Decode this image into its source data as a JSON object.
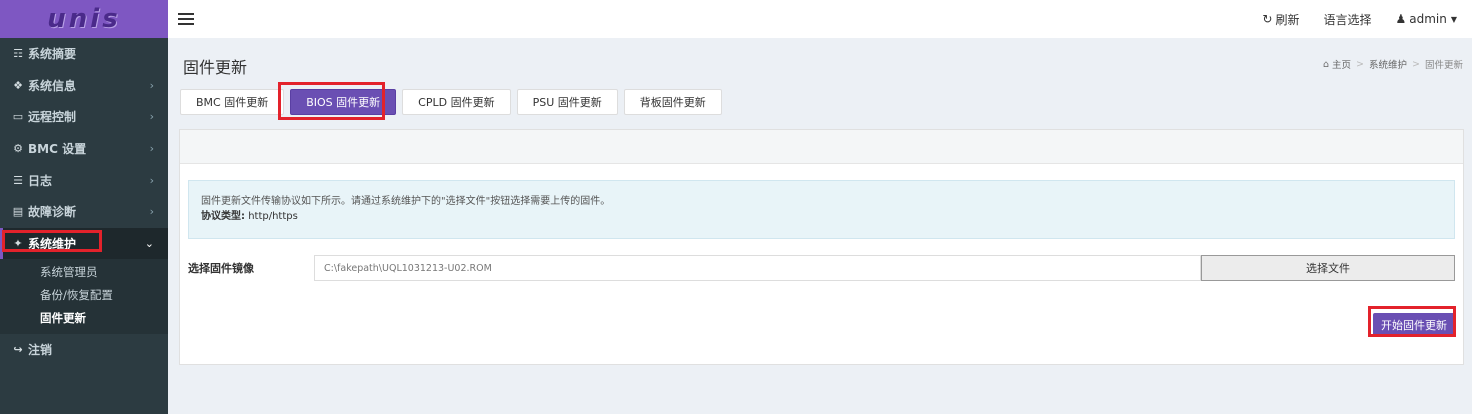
{
  "app": {
    "logo_text": "unis",
    "brand_color": "#7e57c2"
  },
  "header": {
    "refresh_label": "刷新",
    "language_label": "语言选择",
    "user_label": "admin"
  },
  "sidebar": {
    "items": [
      {
        "label": "系统摘要",
        "icon": "dashboard-icon"
      },
      {
        "label": "系统信息",
        "icon": "info-icon"
      },
      {
        "label": "远程控制",
        "icon": "monitor-icon"
      },
      {
        "label": "BMC 设置",
        "icon": "gear-icon"
      },
      {
        "label": "日志",
        "icon": "database-icon"
      },
      {
        "label": "故障诊断",
        "icon": "bar-chart-icon"
      },
      {
        "label": "系统维护",
        "icon": "wrench-icon"
      },
      {
        "label": "注销",
        "icon": "sign-out-icon"
      }
    ],
    "submenu": [
      {
        "label": "系统管理员"
      },
      {
        "label": "备份/恢复配置"
      },
      {
        "label": "固件更新"
      }
    ]
  },
  "page": {
    "title": "固件更新",
    "breadcrumb": {
      "home": "主页",
      "section": "系统维护",
      "current": "固件更新"
    }
  },
  "tabs": [
    {
      "label": "BMC 固件更新"
    },
    {
      "label": "BIOS 固件更新"
    },
    {
      "label": "CPLD 固件更新"
    },
    {
      "label": "PSU 固件更新"
    },
    {
      "label": "背板固件更新"
    }
  ],
  "info": {
    "line1": "固件更新文件传输协议如下所示。请通过系统维护下的\"选择文件\"按钮选择需要上传的固件。",
    "protocol_label": "协议类型:",
    "protocol_value": "http/https"
  },
  "file": {
    "label": "选择固件镜像",
    "value": "C:\\fakepath\\UQL1031213-U02.ROM",
    "choose_label": "选择文件"
  },
  "start_button_label": "开始固件更新"
}
